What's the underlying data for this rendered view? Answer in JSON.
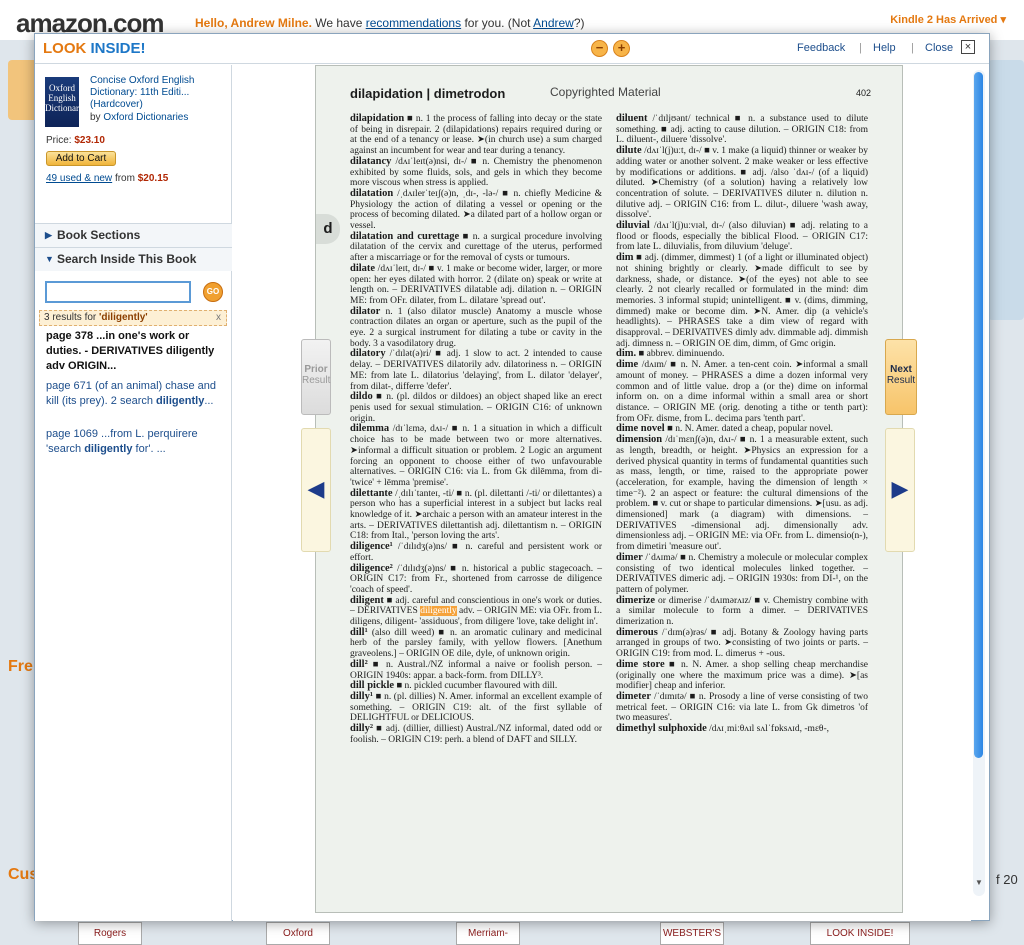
{
  "site": {
    "logo": "amazon.com",
    "greeting_name": "Hello, Andrew Milne.",
    "greeting_mid": " We have ",
    "recommendations": "recommendations",
    "greeting_tail": " for you. (Not ",
    "not_name": "Andrew",
    "greeting_end": "?)",
    "kindle": "Kindle 2 Has Arrived",
    "bg_fre": "Fre",
    "bg_cus": "Cus",
    "bg_of20": "f 20",
    "bottom_books": [
      "Rogers",
      "Oxford",
      "Merriam-Webster",
      "WEBSTER'S",
      "LOOK INSIDE!"
    ]
  },
  "modal": {
    "title_look": "LOOK",
    "title_inside": " INSIDE!",
    "zoom_out": "−",
    "zoom_in": "+",
    "feedback": "Feedback",
    "help": "Help",
    "close": "Close",
    "sep": "|"
  },
  "book": {
    "title": "Concise Oxford English Dictionary: 11th Editi... (Hardcover)",
    "by": "by ",
    "author": "Oxford Dictionaries",
    "cover_text": "Oxford English Dictionary",
    "price_label": "Price: ",
    "price": "$23.10",
    "add_to_cart": "Add to Cart",
    "used_link": "49 used & new",
    "used_from": " from ",
    "used_price": "$20.15"
  },
  "sections": {
    "book_sections": "Book Sections",
    "search_inside": "Search Inside This Book"
  },
  "search": {
    "value": "",
    "go": "GO",
    "results_prefix": "3 results for ",
    "results_term": "'diligently'",
    "results_close": "x",
    "results": [
      {
        "page": "page 378",
        "text": " ...in one's work or duties. - DERIVATIVES diligently adv ORIGIN..."
      },
      {
        "page": "page 671",
        "text": " (of an animal) chase and kill (its prey). 2 search ",
        "term": "diligently",
        "tail": "..."
      },
      {
        "page": "page 1069",
        "text": " ...from L. perquirere 'search ",
        "term": "diligently",
        "tail": " for'. ..."
      }
    ]
  },
  "page": {
    "header": "dilapidation | dimetrodon",
    "copyright": "Copyrighted Material",
    "number": "402",
    "thumb_letter": "d",
    "left_column": [
      {
        "hw": "dilapidation",
        "text": " ■ n. 1 the process of falling into decay or the state of being in disrepair. 2 (dilapidations) repairs required during or at the end of a tenancy or lease. ➤(in church use) a sum charged against an incumbent for wear and tear during a tenancy."
      },
      {
        "hw": "dilatancy",
        "text": " /dʌɪˈleɪt(ə)nsi, dɪ-/ ■ n. Chemistry the phenomenon exhibited by some fluids, sols, and gels in which they become more viscous when stress is applied."
      },
      {
        "hw": "dilatation",
        "text": " /ˌdʌɪlerˈteɪʃ(ə)n, ˌdɪ-, -lə-/ ■ n. chiefly Medicine & Physiology the action of dilating a vessel or opening or the process of becoming dilated. ➤a dilated part of a hollow organ or vessel."
      },
      {
        "hw": "dilatation and curettage",
        "text": " ■ n. a surgical procedure involving dilatation of the cervix and curettage of the uterus, performed after a miscarriage or for the removal of cysts or tumours."
      },
      {
        "hw": "dilate",
        "text": " /dʌɪˈleɪt, dɪ-/ ■ v. 1 make or become wider, larger, or more open: her eyes dilated with horror. 2 (dilate on) speak or write at length on. – DERIVATIVES dilatable adj. dilation n. – ORIGIN ME: from OFr. dilater, from L. dilatare 'spread out'."
      },
      {
        "hw": "dilator",
        "text": " n. 1 (also dilator muscle) Anatomy a muscle whose contraction dilates an organ or aperture, such as the pupil of the eye. 2 a surgical instrument for dilating a tube or cavity in the body. 3 a vasodilatory drug."
      },
      {
        "hw": "dilatory",
        "text": " /ˈdɪlət(ə)ri/ ■ adj. 1 slow to act. 2 intended to cause delay. – DERIVATIVES dilatorily adv. dilatoriness n. – ORIGIN ME: from late L. dilatorius 'delaying', from L. dilator 'delayer', from dilat-, differre 'defer'."
      },
      {
        "hw": "dildo",
        "text": " ■ n. (pl. dildos or dildoes) an object shaped like an erect penis used for sexual stimulation. – ORIGIN C16: of unknown origin."
      },
      {
        "hw": "dilemma",
        "text": " /dɪˈlɛmə, dʌɪ-/ ■ n. 1 a situation in which a difficult choice has to be made between two or more alternatives. ➤informal a difficult situation or problem. 2 Logic an argument forcing an opponent to choose either of two unfavourable alternatives. – ORIGIN C16: via L. from Gk dilēmma, from di- 'twice' + lēmma 'premise'."
      },
      {
        "hw": "dilettante",
        "text": " /ˌdɪlɪˈtanteɪ, -ti/ ■ n. (pl. dilettanti /-ti/ or dilettantes) a person who has a superficial interest in a subject but lacks real knowledge of it. ➤archaic a person with an amateur interest in the arts. – DERIVATIVES dilettantish adj. dilettantism n. – ORIGIN C18: from Ital., 'person loving the arts'."
      },
      {
        "hw": "diligence¹",
        "text": " /ˈdɪlɪdʒ(ə)ns/ ■ n. careful and persistent work or effort."
      },
      {
        "hw": "diligence²",
        "text": " /ˈdɪlɪdʒ(ə)ns/ ■ n. historical a public stagecoach. – ORIGIN C17: from Fr., shortened from carrosse de diligence 'coach of speed'."
      },
      {
        "hw": "diligent",
        "text": " ■ adj. careful and conscientious in one's work or duties. – DERIVATIVES ",
        "hl": "diligently",
        "tail": " adv. – ORIGIN ME: via OFr. from L. diligens, diligent- 'assiduous', from diligere 'love, take delight in'."
      },
      {
        "hw": "dill¹",
        "text": " (also dill weed) ■ n. an aromatic culinary and medicinal herb of the parsley family, with yellow flowers. [Anethum graveolens.] – ORIGIN OE dile, dyle, of unknown origin."
      },
      {
        "hw": "dill²",
        "text": " ■ n. Austral./NZ informal a naive or foolish person. – ORIGIN 1940s: appar. a back-form. from DILLY³."
      },
      {
        "hw": "dill pickle",
        "text": " ■ n. pickled cucumber flavoured with dill."
      },
      {
        "hw": "dilly¹",
        "text": " ■ n. (pl. dillies) N. Amer. informal an excellent example of something. – ORIGIN C19: alt. of the first syllable of DELIGHTFUL or DELICIOUS."
      },
      {
        "hw": "dilly²",
        "text": " ■ adj. (dillier, dilliest) Austral./NZ informal, dated odd or foolish. – ORIGIN C19: perh. a blend of DAFT and SILLY."
      }
    ],
    "right_column": [
      {
        "hw": "diluent",
        "text": " /ˈdɪljʊənt/ technical ■ n. a substance used to dilute something. ■ adj. acting to cause dilution. – ORIGIN C18: from L. diluent-, diluere 'dissolve'."
      },
      {
        "hw": "dilute",
        "text": " /dʌɪˈl(j)uːt, dɪ-/ ■ v. 1 make (a liquid) thinner or weaker by adding water or another solvent. 2 make weaker or less effective by modifications or additions. ■ adj. /also ˈdʌɪ-/ (of a liquid) diluted. ➤Chemistry (of a solution) having a relatively low concentration of solute. – DERIVATIVES diluter n. dilution n. dilutive adj. – ORIGIN C16: from L. dilut-, diluere 'wash away, dissolve'."
      },
      {
        "hw": "diluvial",
        "text": " /dʌɪˈl(j)uːvɪəl, dɪ-/ (also diluvian) ■ adj. relating to a flood or floods, especially the biblical Flood. – ORIGIN C17: from late L. diluvialis, from diluvium 'deluge'."
      },
      {
        "hw": "dim",
        "text": " ■ adj. (dimmer, dimmest) 1 (of a light or illuminated object) not shining brightly or clearly. ➤made difficult to see by darkness, shade, or distance. ➤(of the eyes) not able to see clearly. 2 not clearly recalled or formulated in the mind: dim memories. 3 informal stupid; unintelligent. ■ v. (dims, dimming, dimmed) make or become dim. ➤N. Amer. dip (a vehicle's headlights). – PHRASES take a dim view of regard with disapproval. – DERIVATIVES dimly adv. dimmable adj. dimmish adj. dimness n. – ORIGIN OE dim, dimm, of Gmc origin."
      },
      {
        "hw": "dim.",
        "text": " ■ abbrev. diminuendo."
      },
      {
        "hw": "dime",
        "text": " /dʌɪm/ ■ n. N. Amer. a ten-cent coin. ➤informal a small amount of money. – PHRASES a dime a dozen informal very common and of little value. drop a (or the) dime on informal inform on. on a dime informal within a small area or short distance. – ORIGIN ME (orig. denoting a tithe or tenth part): from OFr. disme, from L. decima pars 'tenth part'."
      },
      {
        "hw": "dime novel",
        "text": " ■ n. N. Amer. dated a cheap, popular novel."
      },
      {
        "hw": "dimension",
        "text": " /dɪˈmɛnʃ(ə)n, dʌɪ-/ ■ n. 1 a measurable extent, such as length, breadth, or height. ➤Physics an expression for a derived physical quantity in terms of fundamental quantities such as mass, length, or time, raised to the appropriate power (acceleration, for example, having the dimension of length × time⁻²). 2 an aspect or feature: the cultural dimensions of the problem. ■ v. cut or shape to particular dimensions. ➤[usu. as adj. dimensioned] mark (a diagram) with dimensions. – DERIVATIVES -dimensional adj. dimensionally adv. dimensionless adj. – ORIGIN ME: via OFr. from L. dimensio(n-), from dimetiri 'measure out'."
      },
      {
        "hw": "dimer",
        "text": " /ˈdʌɪmə/ ■ n. Chemistry a molecule or molecular complex consisting of two identical molecules linked together. – DERIVATIVES dimeric adj. – ORIGIN 1930s: from DI-¹, on the pattern of polymer."
      },
      {
        "hw": "dimerize",
        "text": " or dimerise /ˈdʌɪmərʌɪz/ ■ v. Chemistry combine with a similar molecule to form a dimer. – DERIVATIVES dimerization n."
      },
      {
        "hw": "dimerous",
        "text": " /ˈdɪm(ə)rəs/ ■ adj. Botany & Zoology having parts arranged in groups of two. ➤consisting of two joints or parts. – ORIGIN C19: from mod. L. dimerus + -ous."
      },
      {
        "hw": "dime store",
        "text": " ■ n. N. Amer. a shop selling cheap merchandise (originally one where the maximum price was a dime). ➤[as modifier] cheap and inferior."
      },
      {
        "hw": "dimeter",
        "text": " /ˈdɪmɪtə/ ■ n. Prosody a line of verse consisting of two metrical feet. – ORIGIN C16: via late L. from Gk dimetros 'of two measures'."
      },
      {
        "hw": "dimethyl sulphoxide",
        "text": " /dʌɪˌmiːθʌɪl sʌlˈfɒksʌɪd, -mɛθ-,"
      }
    ]
  },
  "nav": {
    "prior_top": "Prior",
    "prior_bottom": "Result",
    "next_top": "Next",
    "next_bottom": "Result",
    "prev_arrow": "◀",
    "next_arrow": "▶"
  },
  "colors": {
    "accent": "#e47911",
    "link": "#004b91",
    "price": "#b12704",
    "highlight": "#f5a33b"
  }
}
